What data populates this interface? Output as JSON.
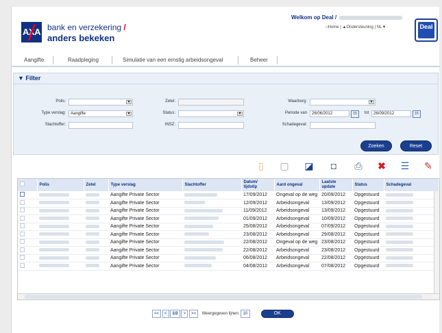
{
  "header": {
    "brand_line1": "bank en verzekering",
    "brand_line2": "anders bekeken",
    "logo_text": "AXA",
    "welcome": "Welkom op Deal /",
    "home_link": "Home",
    "support_link": "Ondersteuning",
    "language": "NL",
    "deal_badge": "Deal"
  },
  "nav": {
    "items": [
      "Aangifte",
      "Raadpleging",
      "Simulatie van een ernstig arbeidsongeval",
      "Beheer"
    ]
  },
  "filter": {
    "title": "Filter",
    "labels": {
      "polis": "Polis:",
      "type_verslag": "Type verslag:",
      "slachtoffer": "Slachtoffer:",
      "zetel": "Zetel:",
      "status": "Status:",
      "insz": "INSZ:",
      "waarborg": "Waarborg:",
      "periode_van": "Periode van",
      "tot": "tot",
      "schadegeval": "Schadegeval:"
    },
    "values": {
      "type_verslag": "Aangifte",
      "date_from": "26/06/2012",
      "date_to": "26/09/2012"
    },
    "buttons": {
      "search": "Zoeken",
      "reset": "Reset"
    }
  },
  "table": {
    "columns": [
      "Polis",
      "Zetel",
      "Type verslag",
      "Slachtoffer",
      "Datum/\ntijdstip",
      "Aard ongeval",
      "Laatste\nupdate",
      "Status",
      "Schadegeval"
    ],
    "rows": [
      {
        "type": "Aangifte Private Sector",
        "date": "17/09/2012",
        "aard": "Ongeval op de weg",
        "update": "20/09/2012",
        "status": "Opgestuurd"
      },
      {
        "type": "Aangifte Private Sector",
        "date": "12/09/2012",
        "aard": "Arbeidsongeval",
        "update": "13/09/2012",
        "status": "Opgestuurd"
      },
      {
        "type": "Aangifte Private Sector",
        "date": "11/09/2012",
        "aard": "Arbeidsongeval",
        "update": "13/09/2012",
        "status": "Opgestuurd"
      },
      {
        "type": "Aangifte Private Sector",
        "date": "01/09/2012",
        "aard": "Arbeidsongeval",
        "update": "10/09/2012",
        "status": "Opgestuurd"
      },
      {
        "type": "Aangifte Private Sector",
        "date": "25/08/2012",
        "aard": "Arbeidsongeval",
        "update": "07/09/2012",
        "status": "Opgestuurd"
      },
      {
        "type": "Aangifte Private Sector",
        "date": "23/08/2012",
        "aard": "Arbeidsongeval",
        "update": "29/08/2012",
        "status": "Opgestuurd"
      },
      {
        "type": "Aangifte Private Sector",
        "date": "22/08/2012",
        "aard": "Ongeval op de weg",
        "update": "23/08/2012",
        "status": "Opgestuurd"
      },
      {
        "type": "Aangifte Private Sector",
        "date": "22/08/2012",
        "aard": "Arbeidsongeval",
        "update": "23/08/2012",
        "status": "Opgestuurd"
      },
      {
        "type": "Aangifte Private Sector",
        "date": "06/08/2012",
        "aard": "Arbeidsongeval",
        "update": "22/08/2012",
        "status": "Opgestuurd"
      },
      {
        "type": "Aangifte Private Sector",
        "date": "04/08/2012",
        "aard": "Arbeidsongeval",
        "update": "07/08/2012",
        "status": "Opgestuurd"
      }
    ]
  },
  "pager": {
    "page": "1/2",
    "lines_label": "Weergegeven lijnen:",
    "lines_value": "10",
    "ok": "OK"
  },
  "toolbar_icons": [
    "new-document-icon",
    "copy-icon",
    "export-icon",
    "view-icon",
    "print-icon",
    "delete-icon",
    "list-icon",
    "settings-icon"
  ]
}
